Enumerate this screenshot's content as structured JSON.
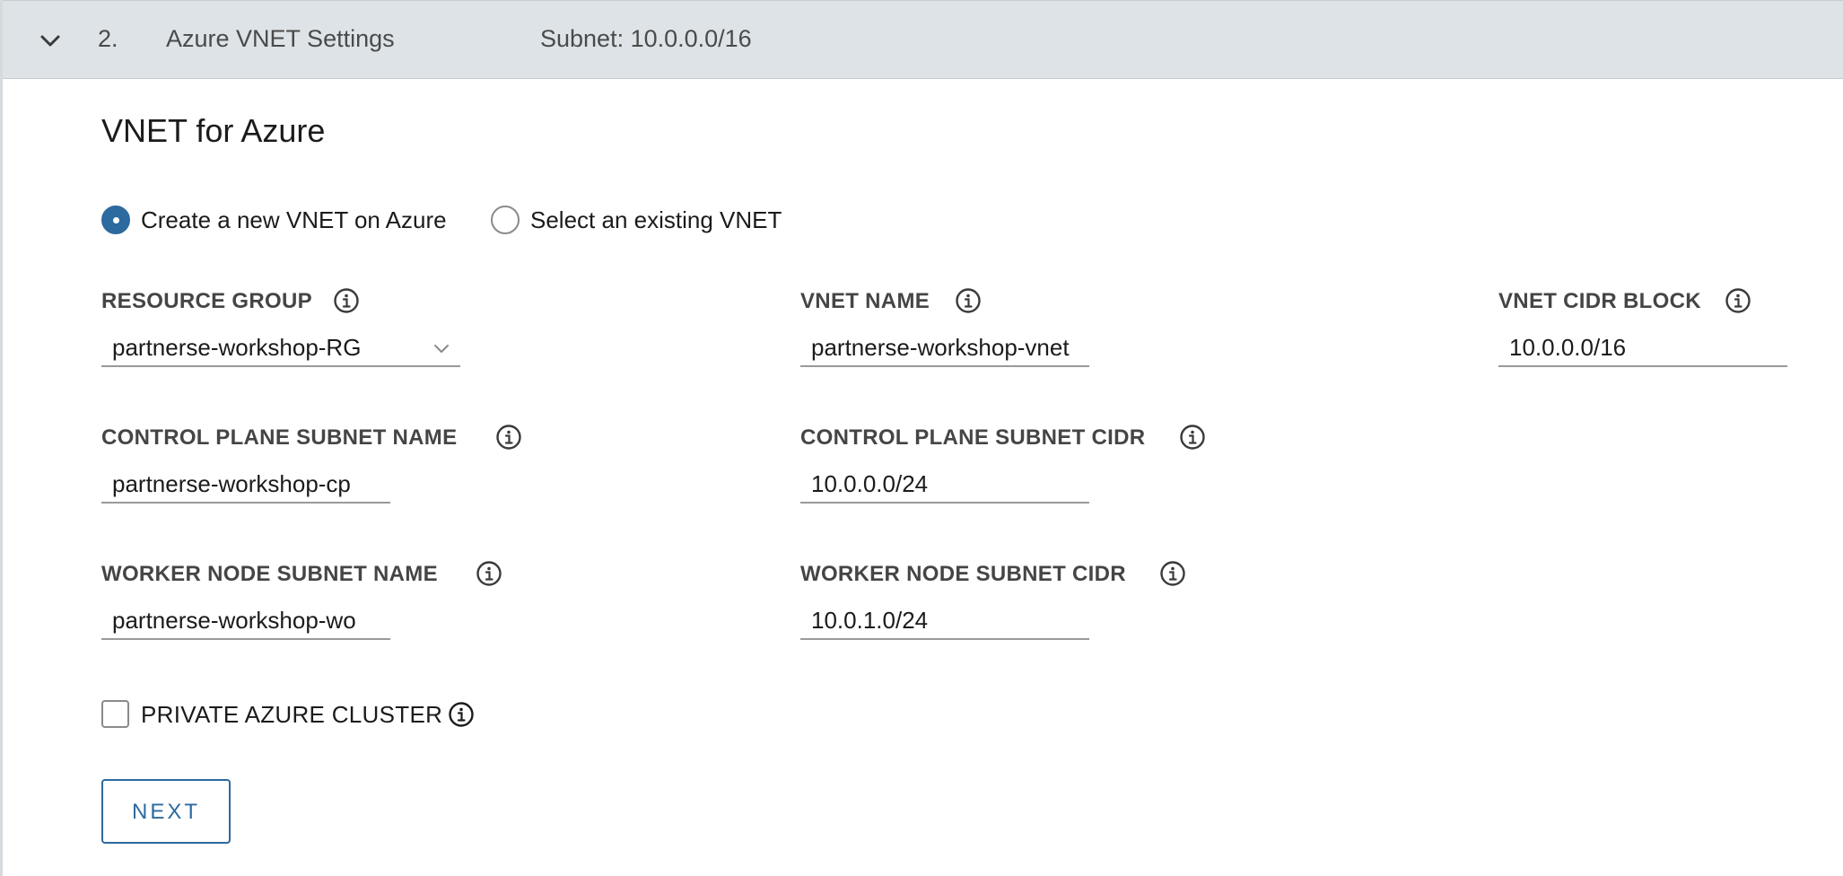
{
  "header": {
    "step_number": "2.",
    "step_title": "Azure VNET Settings",
    "step_subtitle": "Subnet: 10.0.0.0/16",
    "expand_icon": "chevron-down-icon"
  },
  "section": {
    "title": "VNET for Azure"
  },
  "vnet_mode": {
    "options": [
      {
        "label": "Create a new VNET on Azure",
        "selected": true
      },
      {
        "label": "Select an existing VNET",
        "selected": false
      }
    ]
  },
  "fields": {
    "resource_group": {
      "label": "RESOURCE GROUP",
      "value": "partnerse-workshop-RG",
      "info_icon": "info-icon"
    },
    "vnet_name": {
      "label": "VNET NAME",
      "value": "partnerse-workshop-vnet",
      "info_icon": "info-icon"
    },
    "vnet_cidr_block": {
      "label": "VNET CIDR BLOCK",
      "value": "10.0.0.0/16",
      "info_icon": "info-icon"
    },
    "control_plane_subnet_name": {
      "label": "CONTROL PLANE SUBNET NAME",
      "value": "partnerse-workshop-cp",
      "info_icon": "info-icon"
    },
    "control_plane_subnet_cidr": {
      "label": "CONTROL PLANE SUBNET CIDR",
      "value": "10.0.0.0/24",
      "info_icon": "info-icon"
    },
    "worker_node_subnet_name": {
      "label": "WORKER NODE SUBNET NAME",
      "value": "partnerse-workshop-wo",
      "info_icon": "info-icon"
    },
    "worker_node_subnet_cidr": {
      "label": "WORKER NODE SUBNET CIDR",
      "value": "10.0.1.0/24",
      "info_icon": "info-icon"
    }
  },
  "private_cluster": {
    "label": "PRIVATE AZURE CLUSTER",
    "checked": false,
    "info_icon": "info-icon"
  },
  "actions": {
    "next_label": "NEXT"
  },
  "colors": {
    "accent": "#2c6aa0",
    "header_bg": "#dde3e7",
    "label_text": "#454545"
  }
}
